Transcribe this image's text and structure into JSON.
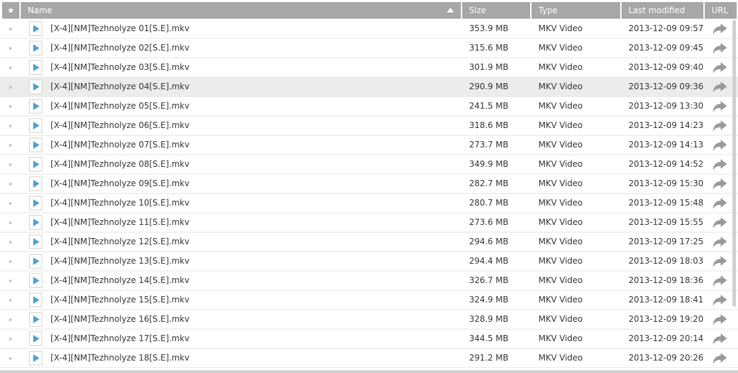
{
  "columns": {
    "star": "★",
    "name": "Name",
    "size": "Size",
    "type": "Type",
    "modified": "Last modified",
    "url": "URL"
  },
  "sort": {
    "column": "name",
    "direction": "ascending"
  },
  "highlighted_row": 3,
  "colors": {
    "header_bg": "#a7a7a7",
    "row_highlight": "#ececec",
    "play_icon": "#4ea1d3",
    "share_icon": "#9a9a9a"
  },
  "files": [
    {
      "name": "[X-4][NM]Tezhnolyze 01[S.E].mkv",
      "size": "353.9 MB",
      "type": "MKV Video",
      "modified": "2013-12-09 09:57"
    },
    {
      "name": "[X-4][NM]Tezhnolyze 02[S.E].mkv",
      "size": "315.6 MB",
      "type": "MKV Video",
      "modified": "2013-12-09 09:45"
    },
    {
      "name": "[X-4][NM]Tezhnolyze 03[S.E].mkv",
      "size": "301.9 MB",
      "type": "MKV Video",
      "modified": "2013-12-09 09:40"
    },
    {
      "name": "[X-4][NM]Tezhnolyze 04[S.E].mkv",
      "size": "290.9 MB",
      "type": "MKV Video",
      "modified": "2013-12-09 09:36"
    },
    {
      "name": "[X-4][NM]Tezhnolyze 05[S.E].mkv",
      "size": "241.5 MB",
      "type": "MKV Video",
      "modified": "2013-12-09 13:30"
    },
    {
      "name": "[X-4][NM]Tezhnolyze 06[S.E].mkv",
      "size": "318.6 MB",
      "type": "MKV Video",
      "modified": "2013-12-09 14:23"
    },
    {
      "name": "[X-4][NM]Tezhnolyze 07[S.E].mkv",
      "size": "273.7 MB",
      "type": "MKV Video",
      "modified": "2013-12-09 14:13"
    },
    {
      "name": "[X-4][NM]Tezhnolyze 08[S.E].mkv",
      "size": "349.9 MB",
      "type": "MKV Video",
      "modified": "2013-12-09 14:52"
    },
    {
      "name": "[X-4][NM]Tezhnolyze 09[S.E].mkv",
      "size": "282.7 MB",
      "type": "MKV Video",
      "modified": "2013-12-09 15:30"
    },
    {
      "name": "[X-4][NM]Tezhnolyze 10[S.E].mkv",
      "size": "280.7 MB",
      "type": "MKV Video",
      "modified": "2013-12-09 15:48"
    },
    {
      "name": "[X-4][NM]Tezhnolyze 11[S.E].mkv",
      "size": "273.6 MB",
      "type": "MKV Video",
      "modified": "2013-12-09 15:55"
    },
    {
      "name": "[X-4][NM]Tezhnolyze 12[S.E].mkv",
      "size": "294.6 MB",
      "type": "MKV Video",
      "modified": "2013-12-09 17:25"
    },
    {
      "name": "[X-4][NM]Tezhnolyze 13[S.E].mkv",
      "size": "294.4 MB",
      "type": "MKV Video",
      "modified": "2013-12-09 18:03"
    },
    {
      "name": "[X-4][NM]Tezhnolyze 14[S.E].mkv",
      "size": "326.7 MB",
      "type": "MKV Video",
      "modified": "2013-12-09 18:36"
    },
    {
      "name": "[X-4][NM]Tezhnolyze 15[S.E].mkv",
      "size": "324.9 MB",
      "type": "MKV Video",
      "modified": "2013-12-09 18:41"
    },
    {
      "name": "[X-4][NM]Tezhnolyze 16[S.E].mkv",
      "size": "328.9 MB",
      "type": "MKV Video",
      "modified": "2013-12-09 19:20"
    },
    {
      "name": "[X-4][NM]Tezhnolyze 17[S.E].mkv",
      "size": "344.5 MB",
      "type": "MKV Video",
      "modified": "2013-12-09 20:14"
    },
    {
      "name": "[X-4][NM]Tezhnolyze 18[S.E].mkv",
      "size": "291.2 MB",
      "type": "MKV Video",
      "modified": "2013-12-09 20:26"
    }
  ]
}
